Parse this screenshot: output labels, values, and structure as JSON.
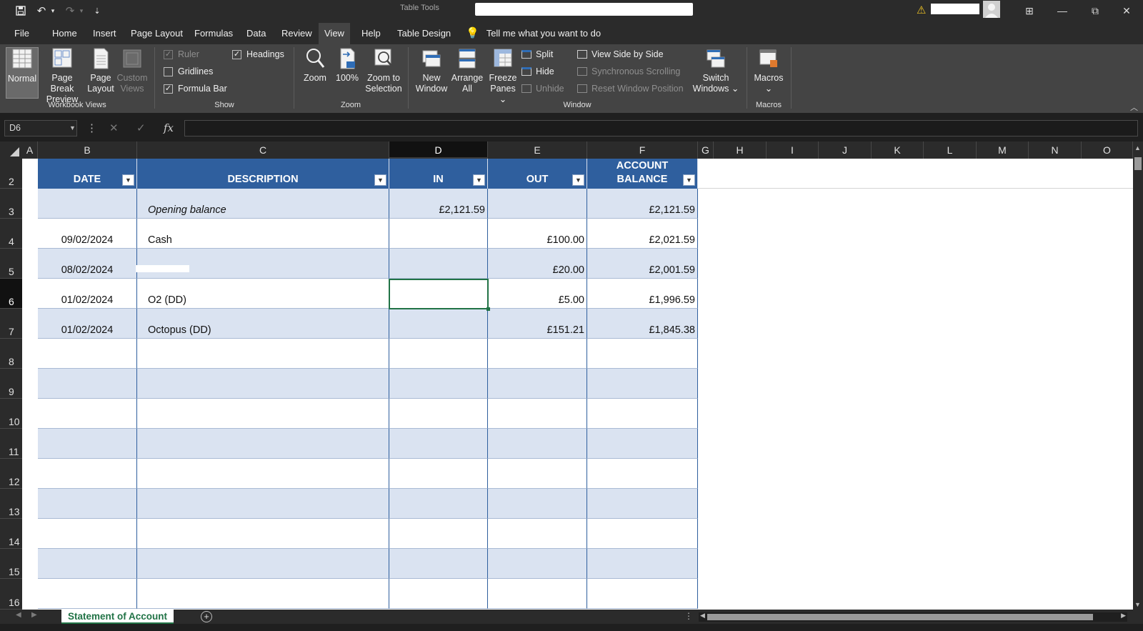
{
  "qat": {
    "undo": "↶",
    "redo": "↷",
    "customize": "⇣"
  },
  "title_bar": {
    "context_label": "Table Tools",
    "restore_icon": "⧉",
    "minimize": "—",
    "close": "✕",
    "ribbon_options": "⊞"
  },
  "tabs": [
    "File",
    "Home",
    "Insert",
    "Page Layout",
    "Formulas",
    "Data",
    "Review",
    "View",
    "Help",
    "Table Design"
  ],
  "active_tab": "View",
  "tell_me": "Tell me what you want to do",
  "ribbon": {
    "workbook_views": {
      "label": "Workbook Views",
      "normal": "Normal",
      "page_break_1": "Page Break",
      "page_break_2": "Preview",
      "page_layout_1": "Page",
      "page_layout_2": "Layout",
      "custom_1": "Custom",
      "custom_2": "Views"
    },
    "show": {
      "label": "Show",
      "ruler": "Ruler",
      "gridlines": "Gridlines",
      "formula_bar": "Formula Bar",
      "headings": "Headings",
      "ruler_checked": true,
      "gridlines_checked": false,
      "formula_bar_checked": true,
      "headings_checked": true
    },
    "zoom": {
      "label": "Zoom",
      "zoom": "Zoom",
      "hundred": "100%",
      "zoom_sel_1": "Zoom to",
      "zoom_sel_2": "Selection"
    },
    "window": {
      "label": "Window",
      "new_1": "New",
      "new_2": "Window",
      "arrange_1": "Arrange",
      "arrange_2": "All",
      "freeze_1": "Freeze",
      "freeze_2": "Panes ⌄",
      "split": "Split",
      "hide": "Hide",
      "unhide": "Unhide",
      "side_by_side": "View Side by Side",
      "sync_scroll": "Synchronous Scrolling",
      "reset_pos": "Reset Window Position",
      "switch_1": "Switch",
      "switch_2": "Windows ⌄"
    },
    "macros": {
      "label": "Macros",
      "btn": "Macros",
      "arrow": "⌄"
    }
  },
  "formula_bar": {
    "name_box": "D6",
    "formula": ""
  },
  "columns": [
    "A",
    "B",
    "C",
    "D",
    "E",
    "F",
    "G",
    "H",
    "I",
    "J",
    "K",
    "L",
    "M",
    "N",
    "O"
  ],
  "active_column": "D",
  "rows": [
    "2",
    "3",
    "4",
    "5",
    "6",
    "7",
    "8",
    "9",
    "10",
    "11",
    "12",
    "13",
    "14",
    "15",
    "16"
  ],
  "active_row": "6",
  "table": {
    "headers": {
      "date": "DATE",
      "description": "DESCRIPTION",
      "in": "IN",
      "out": "OUT",
      "balance_1": "ACCOUNT",
      "balance_2": "BALANCE"
    },
    "rows": [
      {
        "date": "",
        "description": "Opening balance",
        "in": "£2,121.59",
        "out": "",
        "balance": "£2,121.59"
      },
      {
        "date": "09/02/2024",
        "description": "Cash",
        "in": "",
        "out": "£100.00",
        "balance": "£2,021.59"
      },
      {
        "date": "08/02/2024",
        "description": "",
        "in": "",
        "out": "£20.00",
        "balance": "£2,001.59"
      },
      {
        "date": "01/02/2024",
        "description": "O2 (DD)",
        "in": "",
        "out": "£5.00",
        "balance": "£1,996.59"
      },
      {
        "date": "01/02/2024",
        "description": "Octopus (DD)",
        "in": "",
        "out": "£151.21",
        "balance": "£1,845.38"
      },
      {
        "date": "",
        "description": "",
        "in": "",
        "out": "",
        "balance": ""
      },
      {
        "date": "",
        "description": "",
        "in": "",
        "out": "",
        "balance": ""
      },
      {
        "date": "",
        "description": "",
        "in": "",
        "out": "",
        "balance": ""
      },
      {
        "date": "",
        "description": "",
        "in": "",
        "out": "",
        "balance": ""
      },
      {
        "date": "",
        "description": "",
        "in": "",
        "out": "",
        "balance": ""
      },
      {
        "date": "",
        "description": "",
        "in": "",
        "out": "",
        "balance": ""
      },
      {
        "date": "",
        "description": "",
        "in": "",
        "out": "",
        "balance": ""
      },
      {
        "date": "",
        "description": "",
        "in": "",
        "out": "",
        "balance": ""
      },
      {
        "date": "",
        "description": "",
        "in": "",
        "out": "",
        "balance": ""
      }
    ]
  },
  "sheet_tabs": {
    "active": "Statement of Account",
    "add": "+"
  },
  "colors": {
    "table_header": "#2f5f9e",
    "band": "#dae3f1",
    "selection": "#217346",
    "ribbon_bg": "#444444",
    "titlebar_bg": "#2b2b2b"
  }
}
